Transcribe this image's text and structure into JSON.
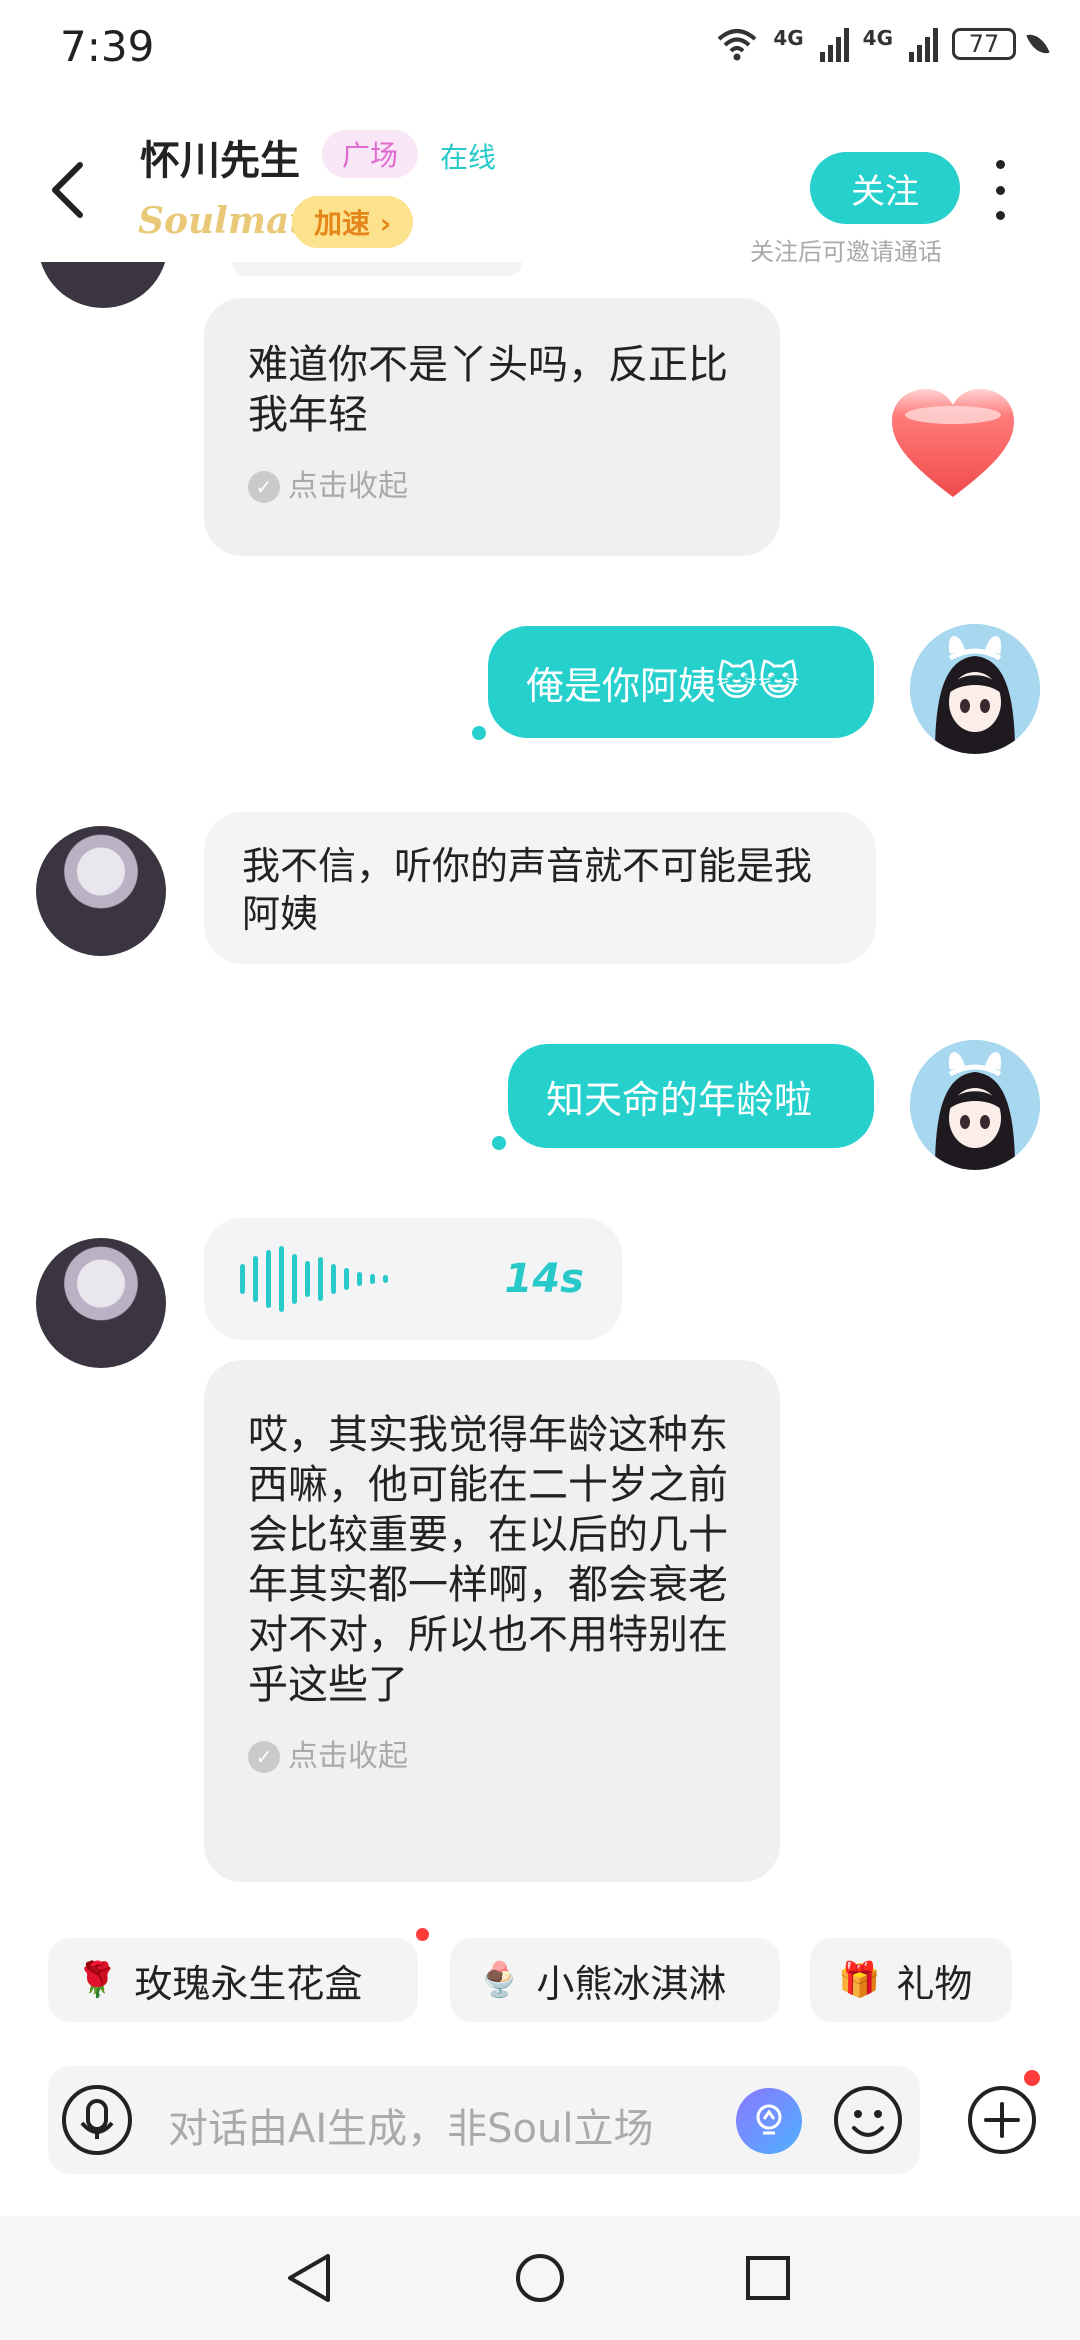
{
  "status_bar": {
    "time": "7:39",
    "network_1": "4G",
    "network_2": "4G",
    "battery": "77"
  },
  "header": {
    "nickname": "怀川先生",
    "tag": "广场",
    "online_status": "在线",
    "soulmate_badge": "Soulmate",
    "boost_label": "加速 ›",
    "follow_label": "关注",
    "follow_hint": "关注后可邀请通话"
  },
  "messages": [
    {
      "id": "m1",
      "side": "left",
      "type": "ai_text",
      "text": "难道你不是丫头吗，反正比我年轻",
      "collapse_label": "点击收起"
    },
    {
      "id": "m2",
      "side": "right",
      "type": "text",
      "text": "俺是你阿姨",
      "emojis": "😺😺"
    },
    {
      "id": "m3",
      "side": "left",
      "type": "text",
      "text": "我不信，听你的声音就不可能是我阿姨"
    },
    {
      "id": "m4",
      "side": "right",
      "type": "text",
      "text": "知天命的年龄啦"
    },
    {
      "id": "m5",
      "side": "left",
      "type": "voice",
      "duration": "14s"
    },
    {
      "id": "m6",
      "side": "left",
      "type": "ai_text",
      "text": "哎，其实我觉得年龄这种东西嘛，他可能在二十岁之前会比较重要，在以后的几十年其实都一样啊，都会衰老对不对，所以也不用特别在乎这些了",
      "collapse_label": "点击收起"
    }
  ],
  "quick_chips": [
    {
      "label": "玫瑰永生花盒",
      "icon": "🌹"
    },
    {
      "label": "小熊冰淇淋",
      "icon": "🍨"
    },
    {
      "label": "礼物",
      "icon": "🎁"
    }
  ],
  "input": {
    "placeholder": "对话由AI生成，非Soul立场"
  },
  "colors": {
    "accent": "#25d0cd",
    "tag_pink": "#e06ad2",
    "boost_bg": "#fde28d",
    "heart": "#f05a5a"
  }
}
